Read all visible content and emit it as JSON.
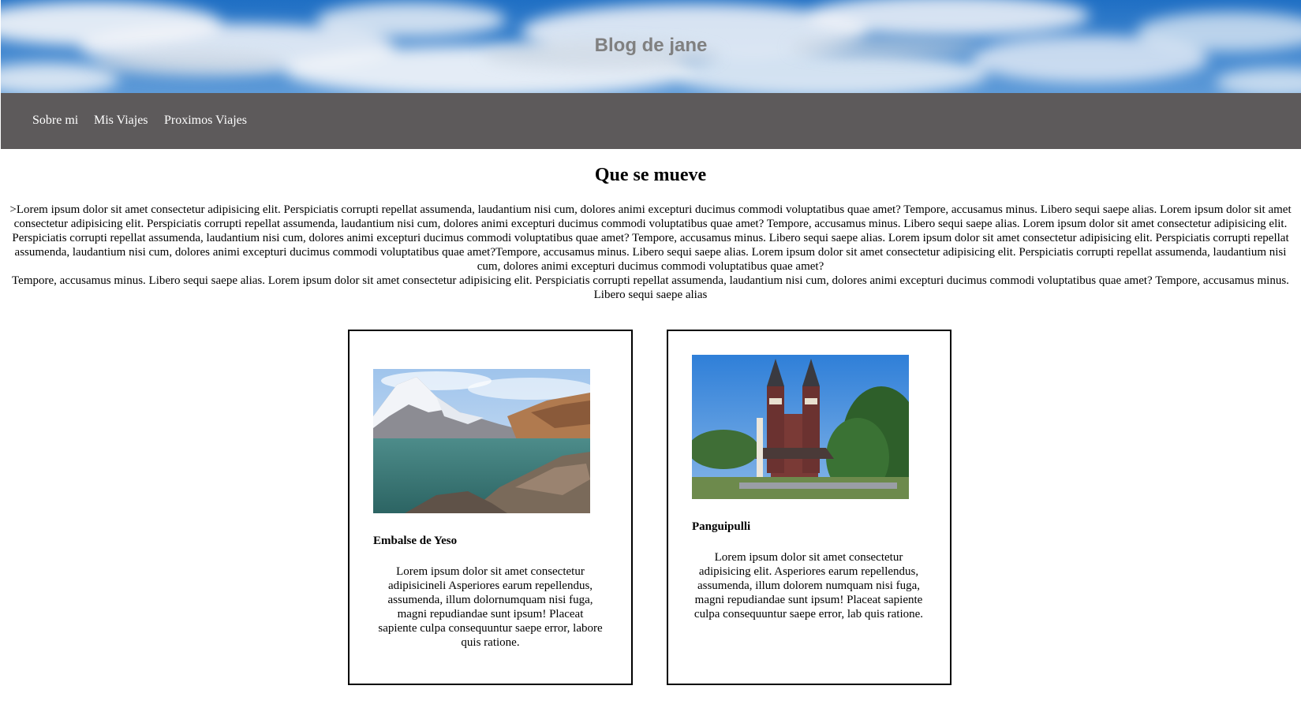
{
  "header": {
    "title": "Blog de jane",
    "banner_image": "sky-with-clouds"
  },
  "nav": {
    "items": [
      {
        "label": "Sobre mi"
      },
      {
        "label": "Mis Viajes"
      },
      {
        "label": "Proximos Viajes"
      }
    ]
  },
  "main": {
    "heading": "Que se mueve",
    "intro_line1": ">Lorem ipsum dolor sit amet consectetur adipisicing elit. Perspiciatis corrupti repellat assumenda, laudantium nisi cum, dolores animi excepturi ducimus commodi voluptatibus quae amet? Tempore, accusamus minus. Libero sequi saepe alias. Lorem ipsum dolor sit amet consectetur adipisicing elit. Perspiciatis corrupti repellat assumenda, laudantium nisi cum, dolores animi excepturi ducimus commodi voluptatibus quae amet? Tempore, accusamus minus. Libero sequi saepe alias. Lorem ipsum dolor sit amet consectetur adipisicing elit. Perspiciatis corrupti repellat assumenda, laudantium nisi cum, dolores animi excepturi ducimus commodi voluptatibus quae amet? Tempore, accusamus minus. Libero sequi saepe alias. Lorem ipsum dolor sit amet consectetur adipisicing elit. Perspiciatis corrupti repellat assumenda, laudantium nisi cum, dolores animi excepturi ducimus commodi voluptatibus quae amet?Tempore, accusamus minus. Libero sequi saepe alias. Lorem ipsum dolor sit amet consectetur adipisicing elit. Perspiciatis corrupti repellat assumenda, laudantium nisi cum, dolores animi excepturi ducimus commodi voluptatibus quae amet?",
    "intro_line2": "Tempore, accusamus minus. Libero sequi saepe alias. Lorem ipsum dolor sit amet consectetur adipisicing elit. Perspiciatis corrupti repellat assumenda, laudantium nisi cum, dolores animi excepturi ducimus commodi voluptatibus quae amet? Tempore, accusamus minus. Libero sequi saepe alias",
    "cards": [
      {
        "title": "Embalse de Yeso",
        "text": "Lorem ipsum dolor sit amet consectetur adipisicineli Asperiores earum repellendus, assumenda, illum dolornumquam nisi fuga, magni repudiandae sunt ipsum! Placeat sapiente culpa consequuntur saepe error, labore quis ratione.",
        "image": "mountain-lake-photo"
      },
      {
        "title": "Panguipulli",
        "text": "Lorem ipsum dolor sit amet consectetur adipisicing elit. Asperiores earum repellendus, assumenda, illum dolorem numquam nisi fuga, magni repudiandae sunt ipsum! Placeat sapiente culpa consequuntur saepe error, lab quis ratione.",
        "image": "church-photo"
      }
    ]
  },
  "colors": {
    "navbar_bg": "#5d5a5b",
    "nav_text": "#ffffff",
    "title_gray": "#808080",
    "card_border": "#000000"
  }
}
